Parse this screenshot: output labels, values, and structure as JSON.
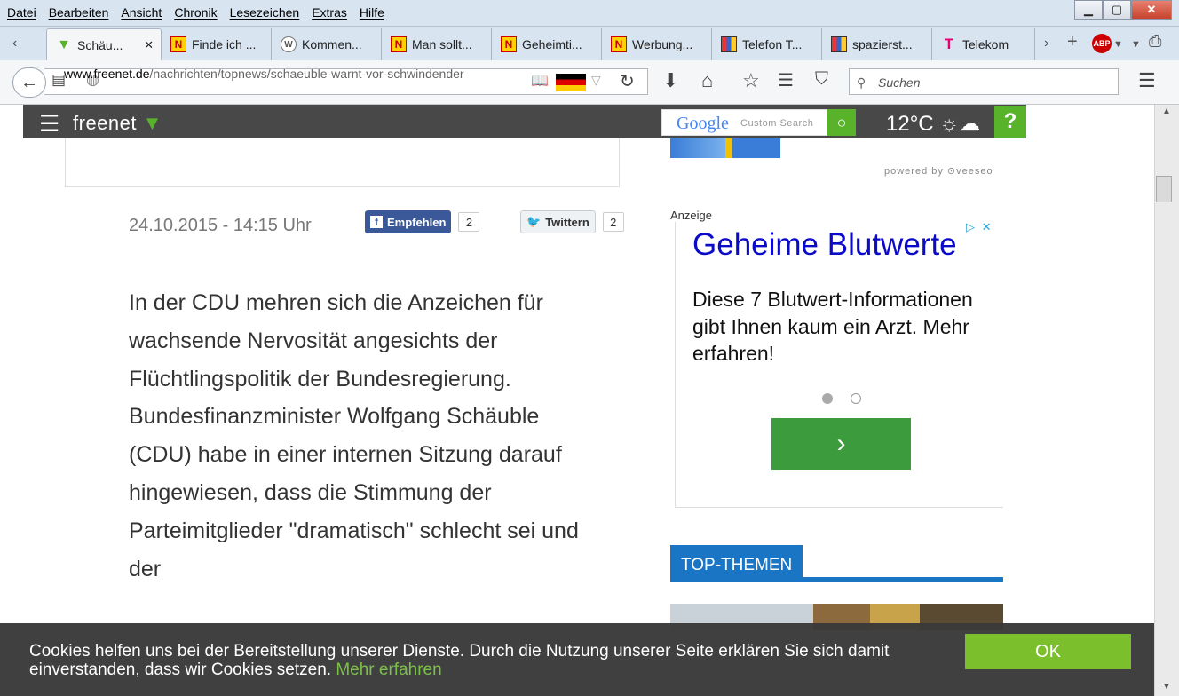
{
  "menubar": {
    "items": [
      "Datei",
      "Bearbeiten",
      "Ansicht",
      "Chronik",
      "Lesezeichen",
      "Extras",
      "Hilfe"
    ]
  },
  "tabs": [
    {
      "label": "Schäu...",
      "icon": "freenet-icon"
    },
    {
      "label": "Finde ich ...",
      "icon": "n-icon"
    },
    {
      "label": "Kommen...",
      "icon": "wordpress-icon"
    },
    {
      "label": "Man sollt...",
      "icon": "n-icon"
    },
    {
      "label": "Geheimti...",
      "icon": "n-icon"
    },
    {
      "label": "Werbung...",
      "icon": "n-icon"
    },
    {
      "label": "Telefon T...",
      "icon": "tv-icon"
    },
    {
      "label": "spazierst...",
      "icon": "tv-icon"
    },
    {
      "label": "Telekom",
      "icon": "telekom-icon"
    }
  ],
  "nav": {
    "url_host": "www.freenet.de",
    "url_path": "/nachrichten/topnews/schaeuble-warnt-vor-schwindender",
    "search_placeholder": "Suchen",
    "abp_label": "ABP"
  },
  "site": {
    "logo": "freenet",
    "google_label": "Google",
    "custom_search": "Custom Search",
    "temperature": "12°C",
    "help": "?",
    "powered_by": "powered by ⊙veeseo"
  },
  "article": {
    "date": "24.10.2015 - 14:15 Uhr",
    "fb_label": "Empfehlen",
    "fb_count": "2",
    "tw_label": "Twittern",
    "tw_count": "2",
    "body": "In der CDU mehren sich die Anzeichen für wachsende Nervosität angesichts der Flüchtlingspolitik der Bundesregierung. Bundesfinanzminister Wolfgang Schäuble (CDU) habe in einer internen Sitzung darauf hingewiesen, dass die Stimmung der Parteimitglieder \"dramatisch\" schlecht sei und der"
  },
  "ad": {
    "label": "Anzeige",
    "title": "Geheime Blutwerte",
    "text": "Diese 7 Blutwert-Informationen gibt Ihnen kaum ein Arzt. Mehr erfahren!",
    "button": "›",
    "adchoices": "▷ ✕"
  },
  "sidebar": {
    "top_themen": "TOP-THEMEN"
  },
  "cookie": {
    "text": "Cookies helfen uns bei der Bereitstellung unserer Dienste. Durch die Nutzung unserer Seite erklären Sie sich damit einverstanden, dass wir Cookies setzen.",
    "link": "Mehr erfahren",
    "ok": "OK"
  },
  "colors": {
    "freenet_green": "#59b32a",
    "header_dark": "#484848",
    "ad_blue": "#0a0ac8",
    "topics_blue": "#1a75c4"
  }
}
